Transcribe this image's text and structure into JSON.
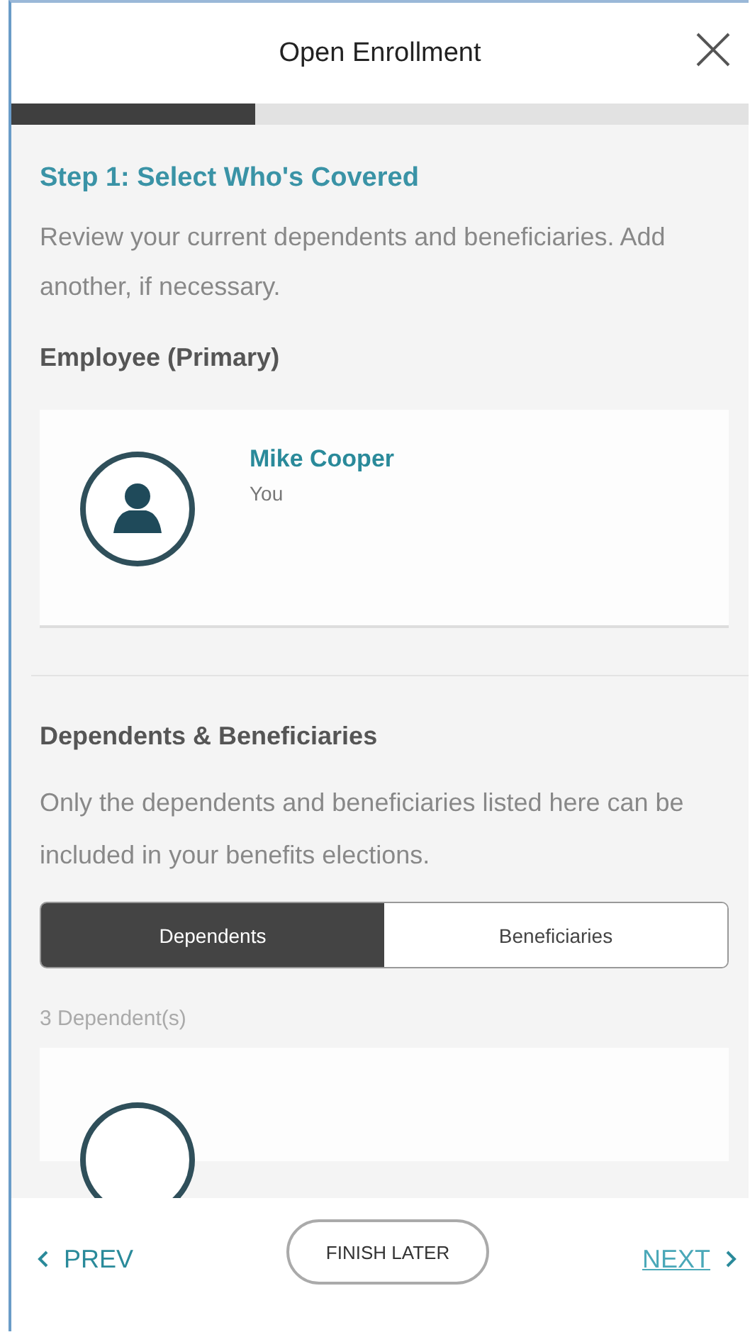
{
  "header": {
    "title": "Open Enrollment"
  },
  "progress": {
    "level": 0.33
  },
  "step": {
    "title": "Step 1: Select Who's Covered",
    "description": "Review your current dependents and beneficiaries. Add another, if necessary."
  },
  "employee": {
    "heading": "Employee (Primary)",
    "name": "Mike Cooper",
    "relation": "You"
  },
  "dependents_section": {
    "heading": "Dependents & Beneficiaries",
    "description": "Only the dependents and beneficiaries listed here can be included in your benefits elections."
  },
  "tabs": [
    {
      "label": "Dependents",
      "selected": true
    },
    {
      "label": "Beneficiaries",
      "selected": false
    }
  ],
  "count": "3 Dependent(s)",
  "footer": {
    "prev": "PREV",
    "finish": "FINISH LATER",
    "next": "NEXT"
  }
}
